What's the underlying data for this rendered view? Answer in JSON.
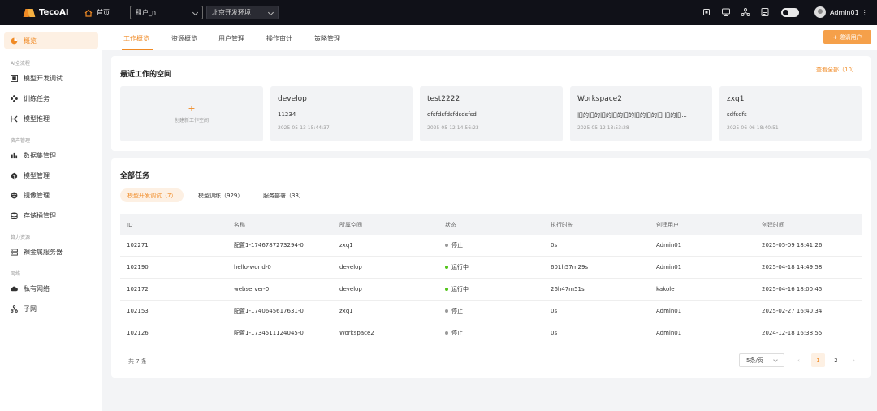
{
  "topbar": {
    "brand": "TecoAI",
    "home": "首页",
    "tenant_select": "租户_n",
    "env_select": "北京开发环境",
    "user": "Admin01",
    "more": "⋮"
  },
  "sidebar": {
    "active": "概览",
    "groups": [
      {
        "label": "AI全流程",
        "items": [
          "模型开发调试",
          "训练任务",
          "模型推理"
        ]
      },
      {
        "label": "资产管理",
        "items": [
          "数据集管理",
          "模型管理",
          "镜像管理",
          "存储桶管理"
        ]
      },
      {
        "label": "算力资源",
        "items": [
          "裸金属服务器"
        ]
      },
      {
        "label": "网络",
        "items": [
          "私有网络",
          "子网"
        ]
      }
    ]
  },
  "tabs": {
    "items": [
      "工作概览",
      "资源概览",
      "用户管理",
      "操作审计",
      "策略管理"
    ],
    "active": 0,
    "invite_button": "+ 邀请用户"
  },
  "recent_workspaces": {
    "title": "最近工作的空间",
    "view_all": "查看全部（10）",
    "new_label": "创建新工作空间",
    "items": [
      {
        "name": "develop",
        "desc": "11234",
        "time": "2025-05-13 15:44:37"
      },
      {
        "name": "test2222",
        "desc": "dfsfdsfdsfdsdsfsd",
        "time": "2025-05-12 14:56:23"
      },
      {
        "name": "Workspace2",
        "desc": "旧的旧的旧的旧的旧的旧的旧的旧 旧的旧...",
        "time": "2025-05-12 13:53:28"
      },
      {
        "name": "zxq1",
        "desc": "sdfsdfs",
        "time": "2025-06-06 18:40:51"
      }
    ]
  },
  "tasks": {
    "title": "全部任务",
    "subtabs": [
      "模型开发调试（7）",
      "模型训练（929）",
      "服务部署（33）"
    ],
    "columns": [
      "ID",
      "名称",
      "所属空间",
      "状态",
      "执行时长",
      "创建用户",
      "创建时间"
    ],
    "rows": [
      {
        "id": "102271",
        "name": "配置1-1746787273294-0",
        "space": "zxq1",
        "status": "停止",
        "status_color": "#999999",
        "duration": "0s",
        "user": "Admin01",
        "created": "2025-05-09 18:41:26"
      },
      {
        "id": "102190",
        "name": "hello-world-0",
        "space": "develop",
        "status": "运行中",
        "status_color": "#52c41a",
        "duration": "601h57m29s",
        "user": "Admin01",
        "created": "2025-04-18 14:49:58"
      },
      {
        "id": "102172",
        "name": "webserver-0",
        "space": "develop",
        "status": "运行中",
        "status_color": "#52c41a",
        "duration": "26h47m51s",
        "user": "kakole",
        "created": "2025-04-16 18:00:45"
      },
      {
        "id": "102153",
        "name": "配置1-1740645617631-0",
        "space": "zxq1",
        "status": "停止",
        "status_color": "#999999",
        "duration": "0s",
        "user": "Admin01",
        "created": "2025-02-27 16:40:34"
      },
      {
        "id": "102126",
        "name": "配置1-1734511124045-0",
        "space": "Workspace2",
        "status": "停止",
        "status_color": "#999999",
        "duration": "0s",
        "user": "Admin01",
        "created": "2024-12-18 16:38:55"
      }
    ],
    "total": "共 7 条",
    "page_size": "5条/页",
    "pages": [
      "1",
      "2"
    ],
    "current_page": 1
  },
  "colors": {
    "accent": "#f08a24",
    "topbar": "#101118"
  }
}
